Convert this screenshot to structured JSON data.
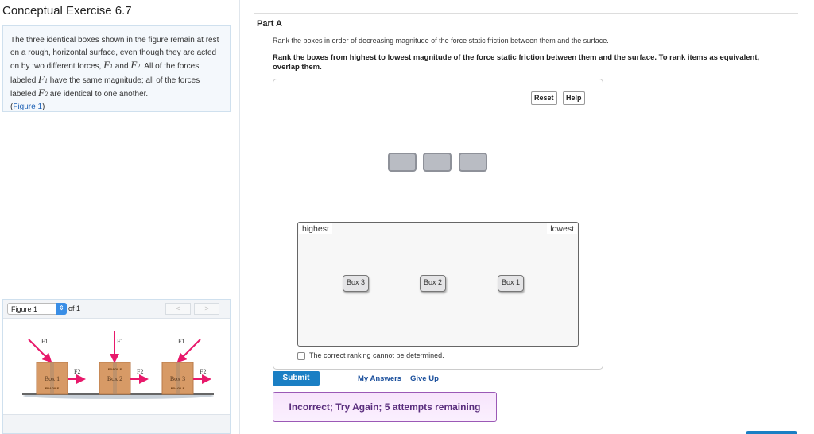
{
  "title": "Conceptual Exercise 6.7",
  "problem": {
    "t1": "The three identical boxes shown in the figure remain at rest on a rough, horizontal surface, even though they are acted on by two different forces,",
    "f1": "F",
    "s1": "1",
    "and": "and",
    "f2": "F",
    "s2": "2",
    "t2": ". All of the forces labeled",
    "t3": "have the same magnitude; all of the forces labeled",
    "t4": "are identical to one another.",
    "fig_link": "Figure 1"
  },
  "figure": {
    "select_value": "Figure 1",
    "of_label": "of 1",
    "prev": "<",
    "next": ">",
    "boxes": [
      "Box 1",
      "Box 2",
      "Box 3"
    ],
    "fragile": "FRAGILE",
    "f1_label": "F1",
    "f2_label": "F2",
    "arrow_color": "#e8196b",
    "box_color": "#d79a66"
  },
  "part": {
    "label": "Part A",
    "question": "Rank the boxes in order of decreasing magnitude of the force static friction between them and the surface.",
    "instructions": "Rank the boxes from highest to lowest magnitude of the force static friction between them and the surface. To rank items as equivalent, overlap them.",
    "reset": "Reset",
    "help": "Help",
    "highest": "highest",
    "lowest": "lowest",
    "ranked": [
      "Box 3",
      "Box 2",
      "Box 1"
    ],
    "cannot_determine": "The correct ranking cannot be determined.",
    "submit": "Submit",
    "my_answers": "My Answers",
    "give_up": "Give Up",
    "feedback": "Incorrect; Try Again; 5 attempts remaining"
  }
}
